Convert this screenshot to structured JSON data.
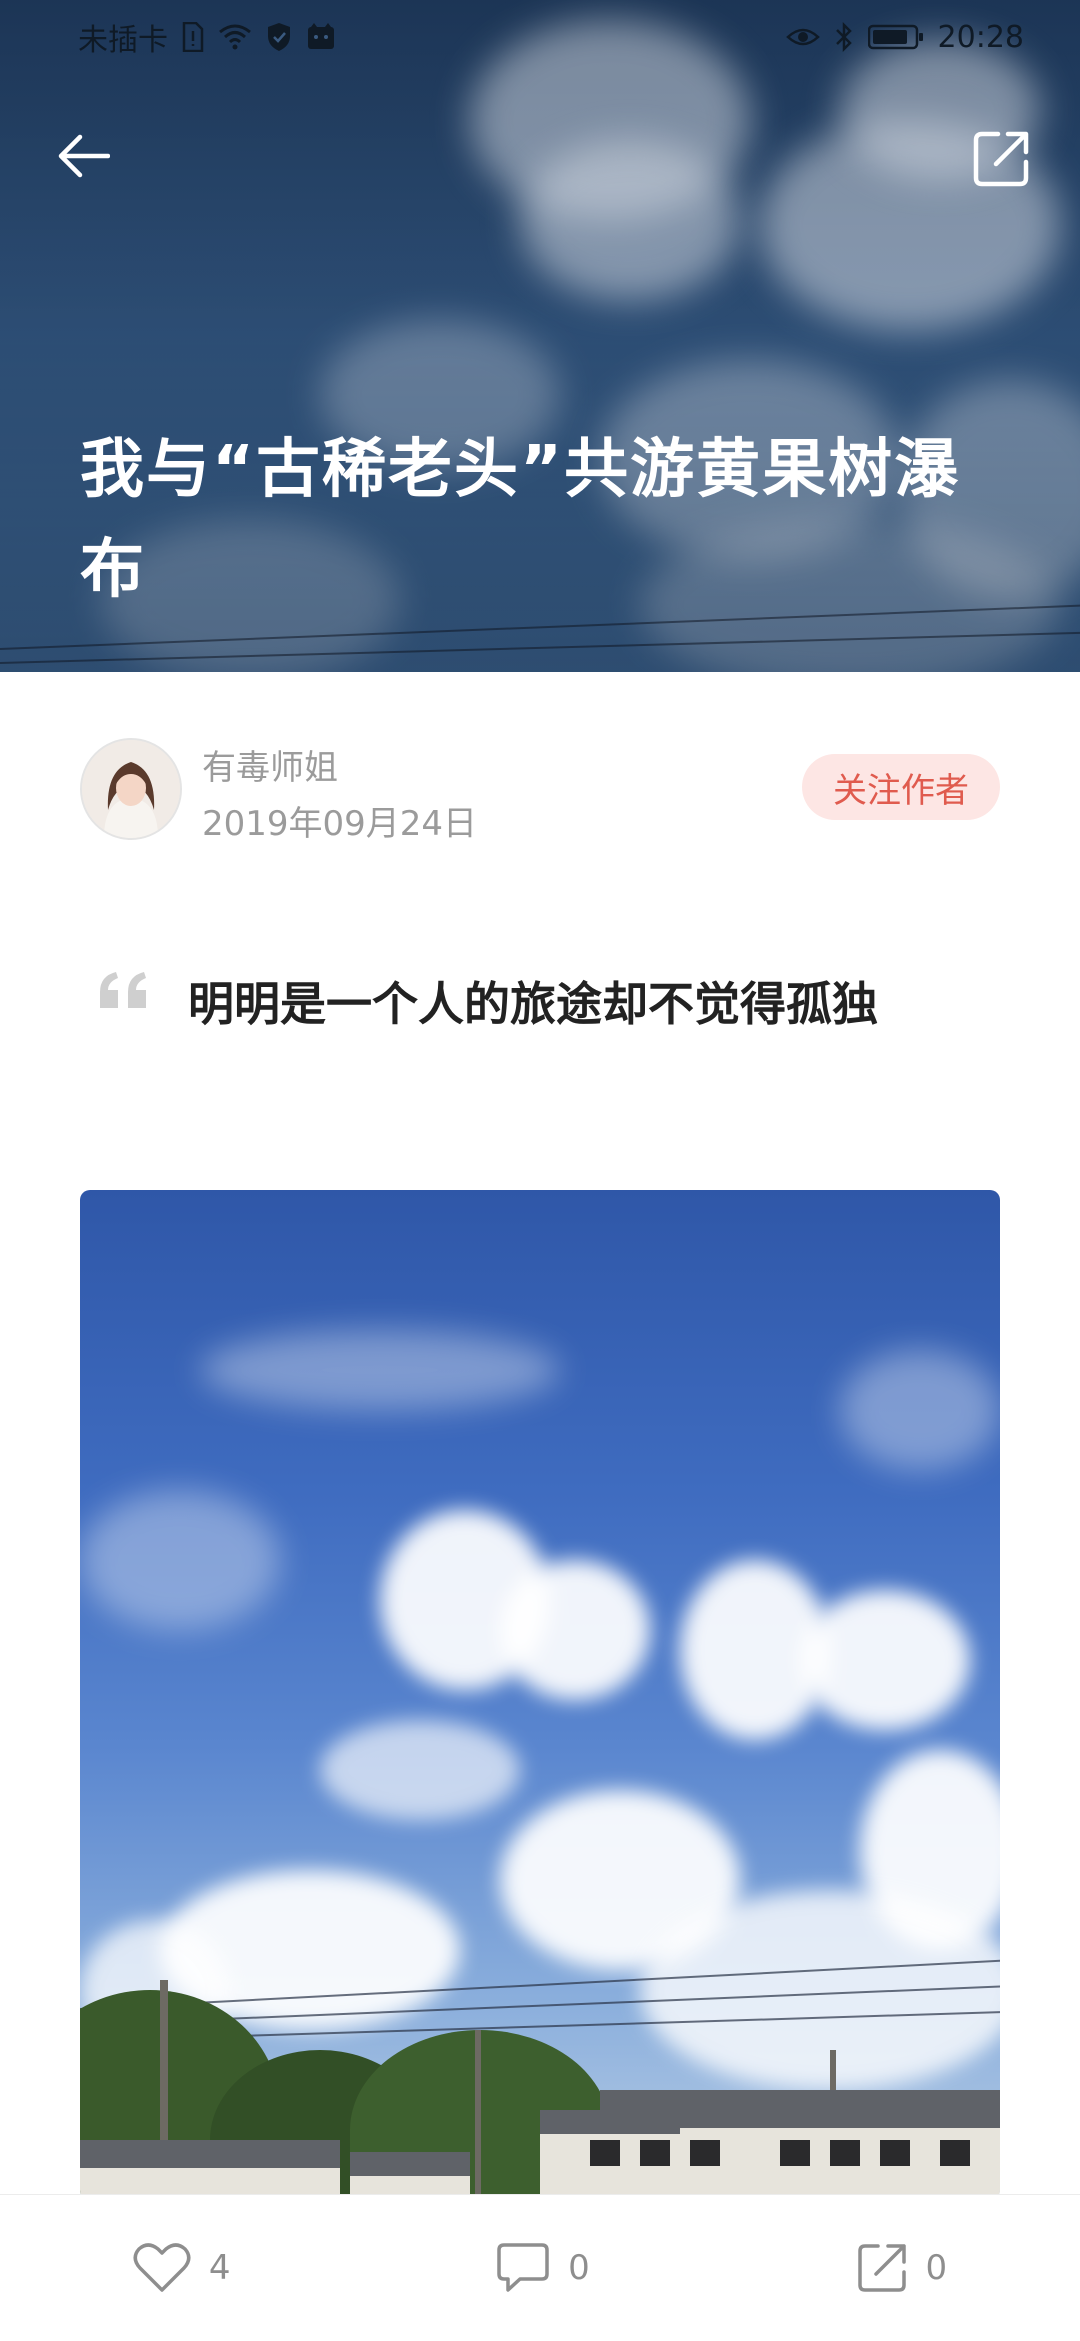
{
  "status_bar": {
    "carrier": "未插卡",
    "time": "20:28",
    "icons": [
      "sim-card-icon",
      "wifi-icon",
      "shield-icon",
      "cat-notification-icon",
      "eye-icon",
      "bluetooth-icon",
      "battery-icon"
    ]
  },
  "header": {
    "back_icon": "back-arrow-icon",
    "share_icon": "share-icon"
  },
  "article": {
    "title": "我与“古稀老头”共游黄果树瀑布",
    "author": {
      "name": "有毒师姐",
      "date": "2019年09月24日"
    },
    "follow_label": "关注作者",
    "quote": "明明是一个人的旅途却不觉得孤独"
  },
  "actions": {
    "like_count": "4",
    "comment_count": "0",
    "share_count": "0"
  },
  "colors": {
    "accent": "#e05b4e",
    "accent_bg": "#fde6e4",
    "muted_text": "#9b9b9b"
  }
}
